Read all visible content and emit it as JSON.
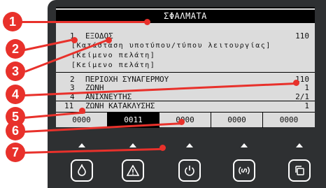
{
  "display": {
    "title": "ΣΦΑΛΜΑΤΑ",
    "rows": [
      {
        "num": "1",
        "label": "ΕΞΟΔΟΣ",
        "value": "110"
      },
      {
        "num": "",
        "label": "[Κατάσταση υποτύπου/τύπου λειτουργίας]",
        "value": ""
      },
      {
        "num": "",
        "label": "[Κείμενο πελάτη]",
        "value": ""
      },
      {
        "num": "",
        "label": "[Κείμενο πελάτη]",
        "value": ""
      },
      {
        "num": "2",
        "label": "ΠΕΡΙΟΧΗ ΣΥΝΑΓΕΡΜΟΥ",
        "value": "110"
      },
      {
        "num": "3",
        "label": "ΖΩΝΗ",
        "value": "1"
      },
      {
        "num": "4",
        "label": "ΑΝΙΧΝΕΥΤΗΣ",
        "value": "2/1"
      },
      {
        "num": "11",
        "label": "ΖΩΝΗ ΚΑΤΑΚΛΥΣΗΣ",
        "value": "1"
      }
    ],
    "slots": [
      "0000",
      "0011",
      "0000",
      "0000",
      "0000"
    ],
    "selected_slot": 1
  },
  "buttons": [
    {
      "icon": "flame-icon"
    },
    {
      "icon": "warning-icon"
    },
    {
      "icon": "power-icon"
    },
    {
      "icon": "signal-icon"
    },
    {
      "icon": "copy-icon"
    }
  ],
  "callouts": [
    "1",
    "2",
    "3",
    "4",
    "5",
    "6",
    "7"
  ],
  "colors": {
    "callout": "#e8312b",
    "panel": "#2e3032",
    "screen": "#dcdcdc"
  }
}
